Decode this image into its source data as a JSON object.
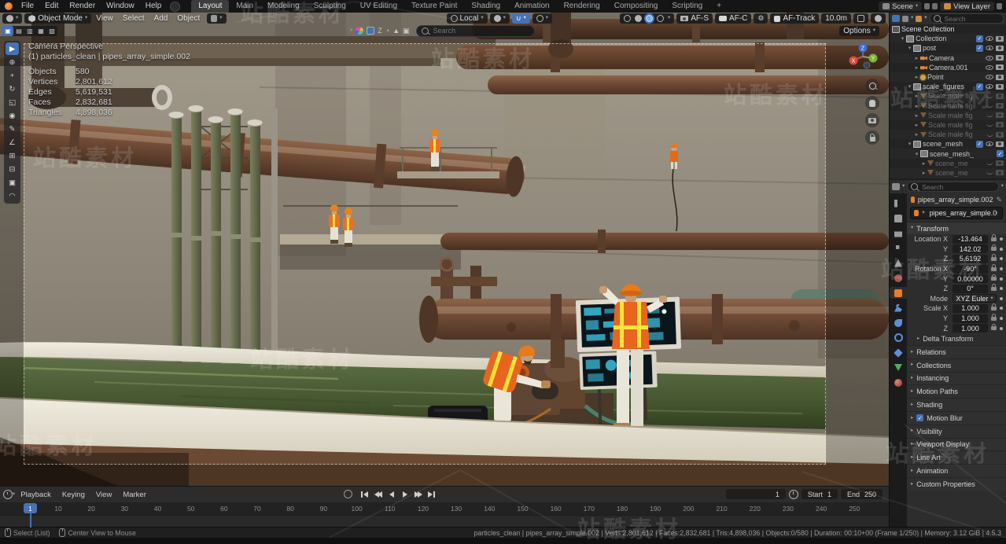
{
  "watermark_text": "站酷素材",
  "topbar": {
    "menus": [
      "File",
      "Edit",
      "Render",
      "Window",
      "Help"
    ],
    "workspaces": [
      "Layout",
      "Main",
      "Modeling",
      "Sculpting",
      "UV Editing",
      "Texture Paint",
      "Shading",
      "Animation",
      "Rendering",
      "Compositing",
      "Scripting",
      "+"
    ],
    "active_workspace": "Layout",
    "scene_label": "Scene",
    "view_layer_label": "View Layer"
  },
  "viewport": {
    "header": {
      "mode": "Object Mode",
      "menus": [
        "View",
        "Select",
        "Add",
        "Object"
      ],
      "orientation": "Local",
      "af_s": "AF-S",
      "af_c": "AF-C",
      "af_track": "AF-Track",
      "af_distance": "10.0m",
      "options": "Options"
    },
    "tool_search_placeholder": "Search",
    "tools": [
      "select-box",
      "cursor",
      "move",
      "rotate",
      "scale",
      "transform",
      "annotate",
      "measure",
      "add-cube",
      "extrude",
      "inset",
      "arc"
    ],
    "stats": {
      "view_name": "Camera Perspective",
      "active_object": "(1) particles_clean | pipes_array_simple.002",
      "rows": [
        {
          "label": "Objects",
          "value": "580"
        },
        {
          "label": "Vertices",
          "value": "2,801,612"
        },
        {
          "label": "Edges",
          "value": "5,619,531"
        },
        {
          "label": "Faces",
          "value": "2,832,681"
        },
        {
          "label": "Triangles",
          "value": "4,898,036"
        }
      ]
    },
    "gizmo": {
      "x": "X",
      "y": "Y",
      "z": "Z"
    }
  },
  "outliner": {
    "search_placeholder": "Search",
    "root_label": "Scene Collection",
    "items": [
      {
        "label": "Collection",
        "depth": 1,
        "icon": "collection",
        "expanded": true,
        "toggles": [
          "checkbox",
          "eye",
          "camera"
        ]
      },
      {
        "label": "post",
        "depth": 2,
        "icon": "collection",
        "expanded": true,
        "toggles": [
          "checkbox",
          "eye",
          "camera"
        ]
      },
      {
        "label": "Camera",
        "depth": 3,
        "icon": "camera",
        "expanded": false,
        "toggles": [
          "eye",
          "camera"
        ]
      },
      {
        "label": "Camera.001",
        "depth": 3,
        "icon": "camera",
        "expanded": false,
        "toggles": [
          "eye",
          "camera"
        ]
      },
      {
        "label": "Point",
        "depth": 3,
        "icon": "light",
        "expanded": false,
        "toggles": [
          "eye",
          "camera"
        ]
      },
      {
        "label": "scale_figures",
        "depth": 2,
        "icon": "collection",
        "expanded": true,
        "toggles": [
          "checkbox",
          "eye",
          "camera"
        ]
      },
      {
        "label": "Scale male fig",
        "depth": 3,
        "icon": "mesh",
        "dim": true,
        "expanded": false,
        "toggles": [
          "eye-closed",
          "camera-dim"
        ]
      },
      {
        "label": "Scale male fig",
        "depth": 3,
        "icon": "mesh",
        "dim": true,
        "expanded": false,
        "toggles": [
          "eye-closed",
          "camera-dim"
        ]
      },
      {
        "label": "Scale male fig",
        "depth": 3,
        "icon": "mesh",
        "dim": true,
        "expanded": false,
        "toggles": [
          "eye-closed",
          "camera-dim"
        ]
      },
      {
        "label": "Scale male fig",
        "depth": 3,
        "icon": "mesh",
        "dim": true,
        "expanded": false,
        "toggles": [
          "eye-closed",
          "camera-dim"
        ]
      },
      {
        "label": "Scale male fig",
        "depth": 3,
        "icon": "mesh",
        "dim": true,
        "expanded": false,
        "toggles": [
          "eye-closed",
          "camera-dim"
        ]
      },
      {
        "label": "scene_mesh",
        "depth": 2,
        "icon": "collection",
        "expanded": true,
        "toggles": [
          "checkbox",
          "eye",
          "camera"
        ]
      },
      {
        "label": "scene_mesh_",
        "depth": 3,
        "icon": "collection",
        "expanded": true,
        "toggles": [
          "checkbox"
        ]
      },
      {
        "label": "scene_me",
        "depth": 4,
        "icon": "mesh",
        "dim": true,
        "expanded": false,
        "toggles": [
          "eye-closed",
          "camera-dim"
        ]
      },
      {
        "label": "scene_me",
        "depth": 4,
        "icon": "mesh",
        "dim": true,
        "expanded": false,
        "toggles": [
          "eye-closed",
          "camera-dim"
        ]
      }
    ]
  },
  "properties": {
    "search_placeholder": "Search",
    "tabs": [
      "tool",
      "render",
      "output",
      "view-layer",
      "scene",
      "world",
      "object",
      "modifiers",
      "particles",
      "physics",
      "constraints",
      "data",
      "material"
    ],
    "active_tab": "object",
    "breadcrumb_object": "pipes_array_simple.002",
    "object_name": "pipes_array_simple.002",
    "transform": {
      "title": "Transform",
      "rows": [
        {
          "label": "Location X",
          "value": "-13.464",
          "lock": true
        },
        {
          "label": "Y",
          "value": "142.02",
          "lock": true
        },
        {
          "label": "Z",
          "value": "5.6192",
          "lock": true
        },
        {
          "label": "Rotation X",
          "value": "-90°",
          "lock": true
        },
        {
          "label": "Y",
          "value": "0.00000",
          "lock": true
        },
        {
          "label": "Z",
          "value": "0°",
          "lock": true
        },
        {
          "label": "Mode",
          "value": "XYZ Euler",
          "dropdown": true
        },
        {
          "label": "Scale X",
          "value": "1.000",
          "lock": true
        },
        {
          "label": "Y",
          "value": "1.000",
          "lock": true
        },
        {
          "label": "Z",
          "value": "1.000",
          "lock": true
        }
      ],
      "subpanel": "Delta Transform"
    },
    "panels": [
      {
        "label": "Relations"
      },
      {
        "label": "Collections"
      },
      {
        "label": "Instancing"
      },
      {
        "label": "Motion Paths"
      },
      {
        "label": "Shading"
      },
      {
        "label": "Motion Blur",
        "checkbox": true
      },
      {
        "label": "Visibility"
      },
      {
        "label": "Viewport Display"
      },
      {
        "label": "Line Art"
      },
      {
        "label": "Animation"
      },
      {
        "label": "Custom Properties"
      }
    ]
  },
  "timeline": {
    "menus": [
      "Playback",
      "Keying",
      "View",
      "Marker"
    ],
    "ticks": [
      1,
      10,
      20,
      30,
      40,
      50,
      60,
      70,
      80,
      90,
      100,
      110,
      120,
      130,
      140,
      150,
      160,
      170,
      180,
      190,
      200,
      210,
      220,
      230,
      240,
      250
    ],
    "current_frame": "1",
    "frame_field": "1",
    "start_label": "Start",
    "start_value": "1",
    "end_label": "End",
    "end_value": "250"
  },
  "statusbar": {
    "left": [
      "Select (List)",
      "Center View to Mouse"
    ],
    "info": "particles_clean | pipes_array_simple.002 | Verts:2,801,612 | Faces:2,832,681 | Tris:4,898,036 | Objects:0/580 | Duration: 00:10+00 (Frame 1/250) | Memory: 3.12 GiB | 4.5.3"
  },
  "colors": {
    "accent": "#4772b3",
    "object_orange": "#e87d2c",
    "vest_orange": "#e8651f",
    "hazard_yellow": "#ffe23a",
    "screen_cyan": "#3fc9e8",
    "water_green": "#4f603a"
  }
}
